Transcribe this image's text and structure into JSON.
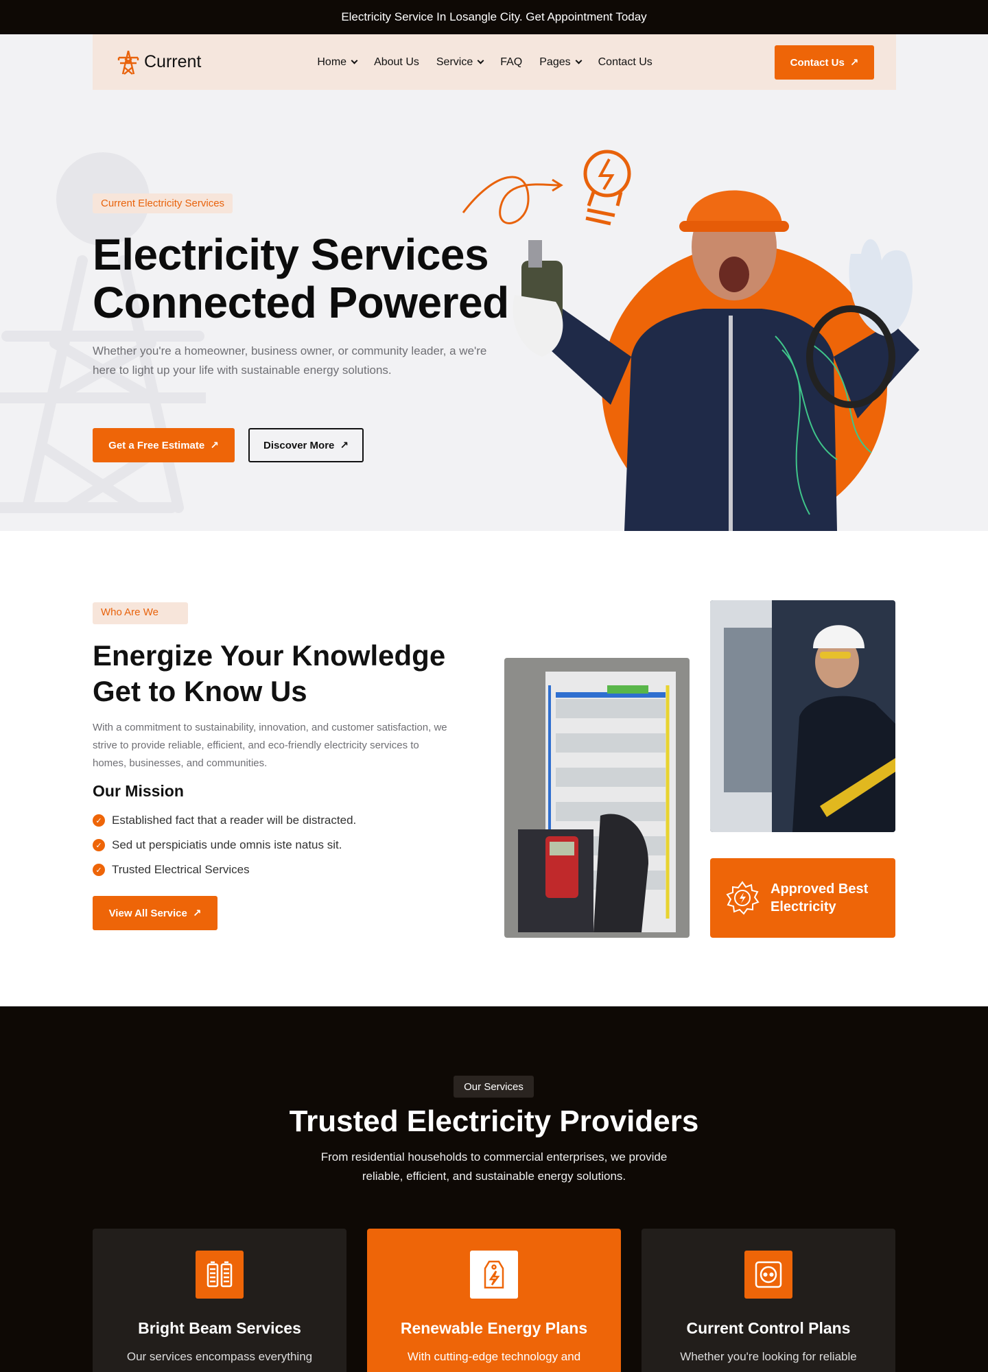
{
  "topbar": {
    "text": "Electricity Service In Losangle City. Get Appointment Today"
  },
  "nav": {
    "logo": "Current",
    "items": [
      {
        "label": "Home",
        "dropdown": true
      },
      {
        "label": "About Us",
        "dropdown": false
      },
      {
        "label": "Service",
        "dropdown": true
      },
      {
        "label": "FAQ",
        "dropdown": false
      },
      {
        "label": "Pages",
        "dropdown": true
      },
      {
        "label": "Contact Us",
        "dropdown": false
      }
    ],
    "contact_button": "Contact Us"
  },
  "hero": {
    "tag": "Current Electricity Services",
    "title_line1": "Electricity Services",
    "title_line2": "Connected Powered",
    "text": "Whether you're a homeowner, business owner, or community leader, a we're here to light up your life with sustainable energy solutions.",
    "primary_button": "Get a Free Estimate",
    "secondary_button": "Discover More"
  },
  "about": {
    "tag": "Who Are We",
    "title_line1": "Energize Your Knowledge",
    "title_line2": "Get to Know Us",
    "text": "With a commitment to sustainability, innovation, and customer satisfaction, we strive to provide reliable, efficient, and eco-friendly electricity services to homes, businesses, and communities.",
    "mission_heading": "Our Mission",
    "mission_items": [
      "Established fact that a reader will be distracted.",
      "Sed ut perspiciatis unde omnis iste natus sit.",
      "Trusted Electrical Services"
    ],
    "button": "View All Service",
    "approved_line1": "Approved Best",
    "approved_line2": "Electricity"
  },
  "services": {
    "tag": "Our Services",
    "title": "Trusted Electricity Providers",
    "text": "From residential households to commercial enterprises, we provide reliable, efficient, and sustainable energy solutions.",
    "cards": [
      {
        "title": "Bright Beam Services",
        "text": "Our services encompass everything",
        "icon": "battery-icon"
      },
      {
        "title": "Renewable Energy Plans",
        "text": "With cutting-edge technology and",
        "icon": "energy-tag-icon"
      },
      {
        "title": "Current Control Plans",
        "text": "Whether you're looking for reliable",
        "icon": "socket-icon"
      }
    ]
  },
  "colors": {
    "accent": "#ee6508",
    "dark": "#0e0905",
    "nav_bg": "#f5e6dd",
    "hero_bg": "#f2f2f4"
  }
}
